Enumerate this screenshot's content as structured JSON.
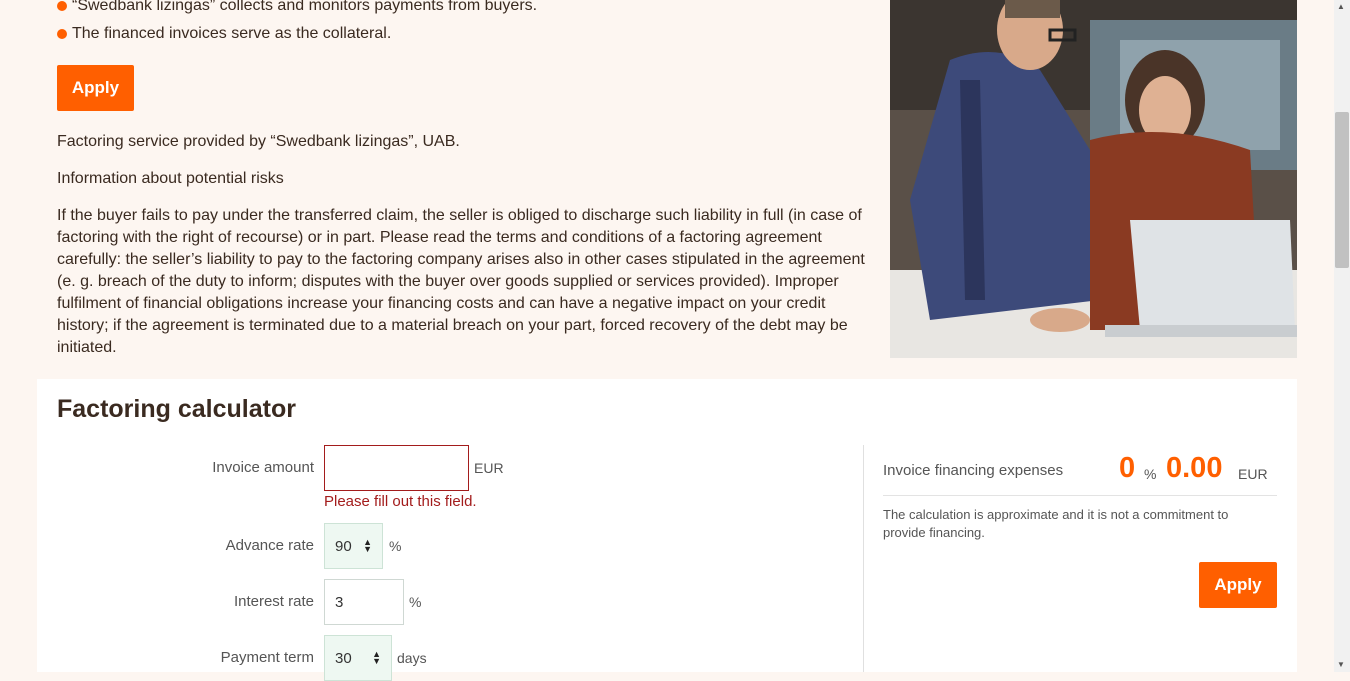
{
  "info": {
    "bullets": [
      "“Swedbank lizingas” collects and monitors payments from buyers.",
      "The financed invoices serve as the collateral."
    ],
    "apply_label": "Apply",
    "provided_by": "Factoring service provided by “Swedbank lizingas”, UAB.",
    "risks_title": "Information about potential risks",
    "risks_text": "If the buyer fails to pay under the transferred claim, the seller is obliged to discharge such liability in full (in case of factoring with the right of recourse) or in part. Please read the terms and conditions of a factoring agreement carefully: the seller’s liability to pay to the factoring company arises also in other cases stipulated in the agreement (e. g. breach of the duty to inform; disputes with the buyer over goods supplied or services provided). Improper fulfilment of financial obligations increase your financing costs and can have a negative impact on your credit history; if the agreement is terminated due to a material breach on your part, forced recovery of the debt may be initiated."
  },
  "calculator": {
    "title": "Factoring calculator",
    "invoice_amount": {
      "label": "Invoice amount",
      "value": "",
      "unit": "EUR",
      "error": "Please fill out this field."
    },
    "advance_rate": {
      "label": "Advance rate",
      "value": "90",
      "unit": "%"
    },
    "interest_rate": {
      "label": "Interest rate",
      "value": "3",
      "unit": "%"
    },
    "payment_term": {
      "label": "Payment term",
      "value": "30",
      "unit": "days"
    },
    "result": {
      "label": "Invoice financing expenses",
      "percent_value": "0",
      "percent_unit": "%",
      "amount_value": "0.00",
      "amount_unit": "EUR",
      "note": "The calculation is approximate and it is not a commitment to provide financing."
    },
    "apply_label": "Apply"
  },
  "colors": {
    "accent": "#ff5f00",
    "error": "#a31c1c",
    "background": "#fdf6f1"
  }
}
